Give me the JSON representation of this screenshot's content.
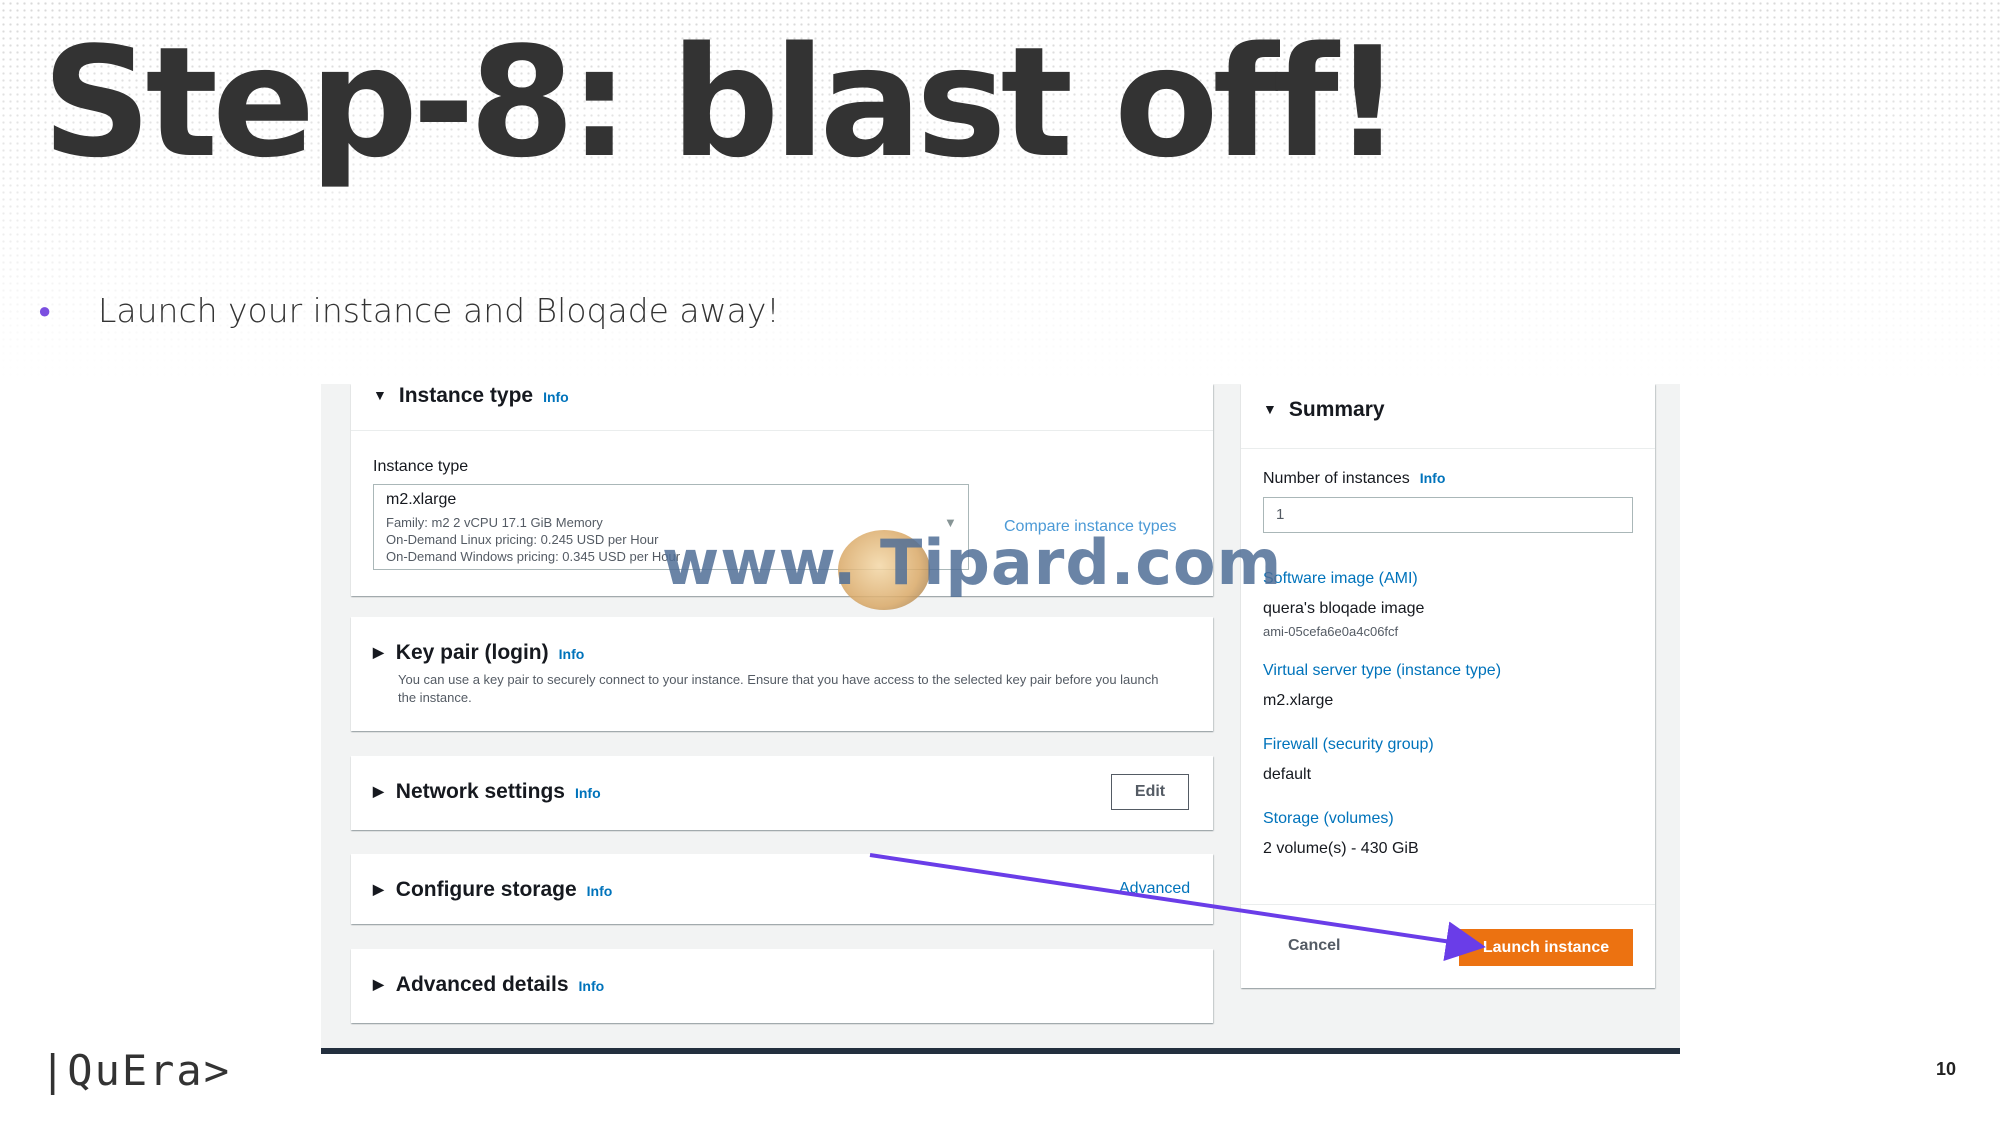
{
  "slide": {
    "title": "Step-8: blast off!",
    "bullet": "Launch your instance and Bloqade away!",
    "page_number": "10",
    "logo_text": "|QuEra>"
  },
  "instance_type": {
    "heading": "Instance type",
    "info": "Info",
    "field_label": "Instance type",
    "selected": "m2.xlarge",
    "family_line": "Family: m2     2 vCPU     17.1 GiB Memory",
    "linux_line": "On-Demand Linux pricing: 0.245 USD per Hour",
    "windows_line": "On-Demand Windows pricing: 0.345 USD per Hour",
    "compare_link": "Compare instance types"
  },
  "key_pair": {
    "heading": "Key pair (login)",
    "info": "Info",
    "description": "You can use a key pair to securely connect to your instance. Ensure that you have access to the selected key pair before you launch the instance."
  },
  "network": {
    "heading": "Network settings",
    "info": "Info",
    "edit_label": "Edit"
  },
  "storage": {
    "heading": "Configure storage",
    "info": "Info",
    "advanced_link": "Advanced"
  },
  "advanced": {
    "heading": "Advanced details",
    "info": "Info"
  },
  "summary": {
    "heading": "Summary",
    "num_instances_label": "Number of instances",
    "info": "Info",
    "num_instances_value": "1",
    "ami_label": "Software image (AMI)",
    "ami_name": "quera's bloqade image",
    "ami_id": "ami-05cefa6e0a4c06fcf",
    "server_type_label": "Virtual server type (instance type)",
    "server_type_value": "m2.xlarge",
    "firewall_label": "Firewall (security group)",
    "firewall_value": "default",
    "storage_label": "Storage (volumes)",
    "storage_value": "2 volume(s) - 430 GiB",
    "cancel_label": "Cancel",
    "launch_label": "Launch instance"
  },
  "watermark": {
    "text": "www.  Tipard.com"
  },
  "colors": {
    "accent_bullet": "#7b4fe0",
    "arrow": "#6a3de8",
    "launch_button": "#ec7211",
    "link": "#0073bb"
  }
}
